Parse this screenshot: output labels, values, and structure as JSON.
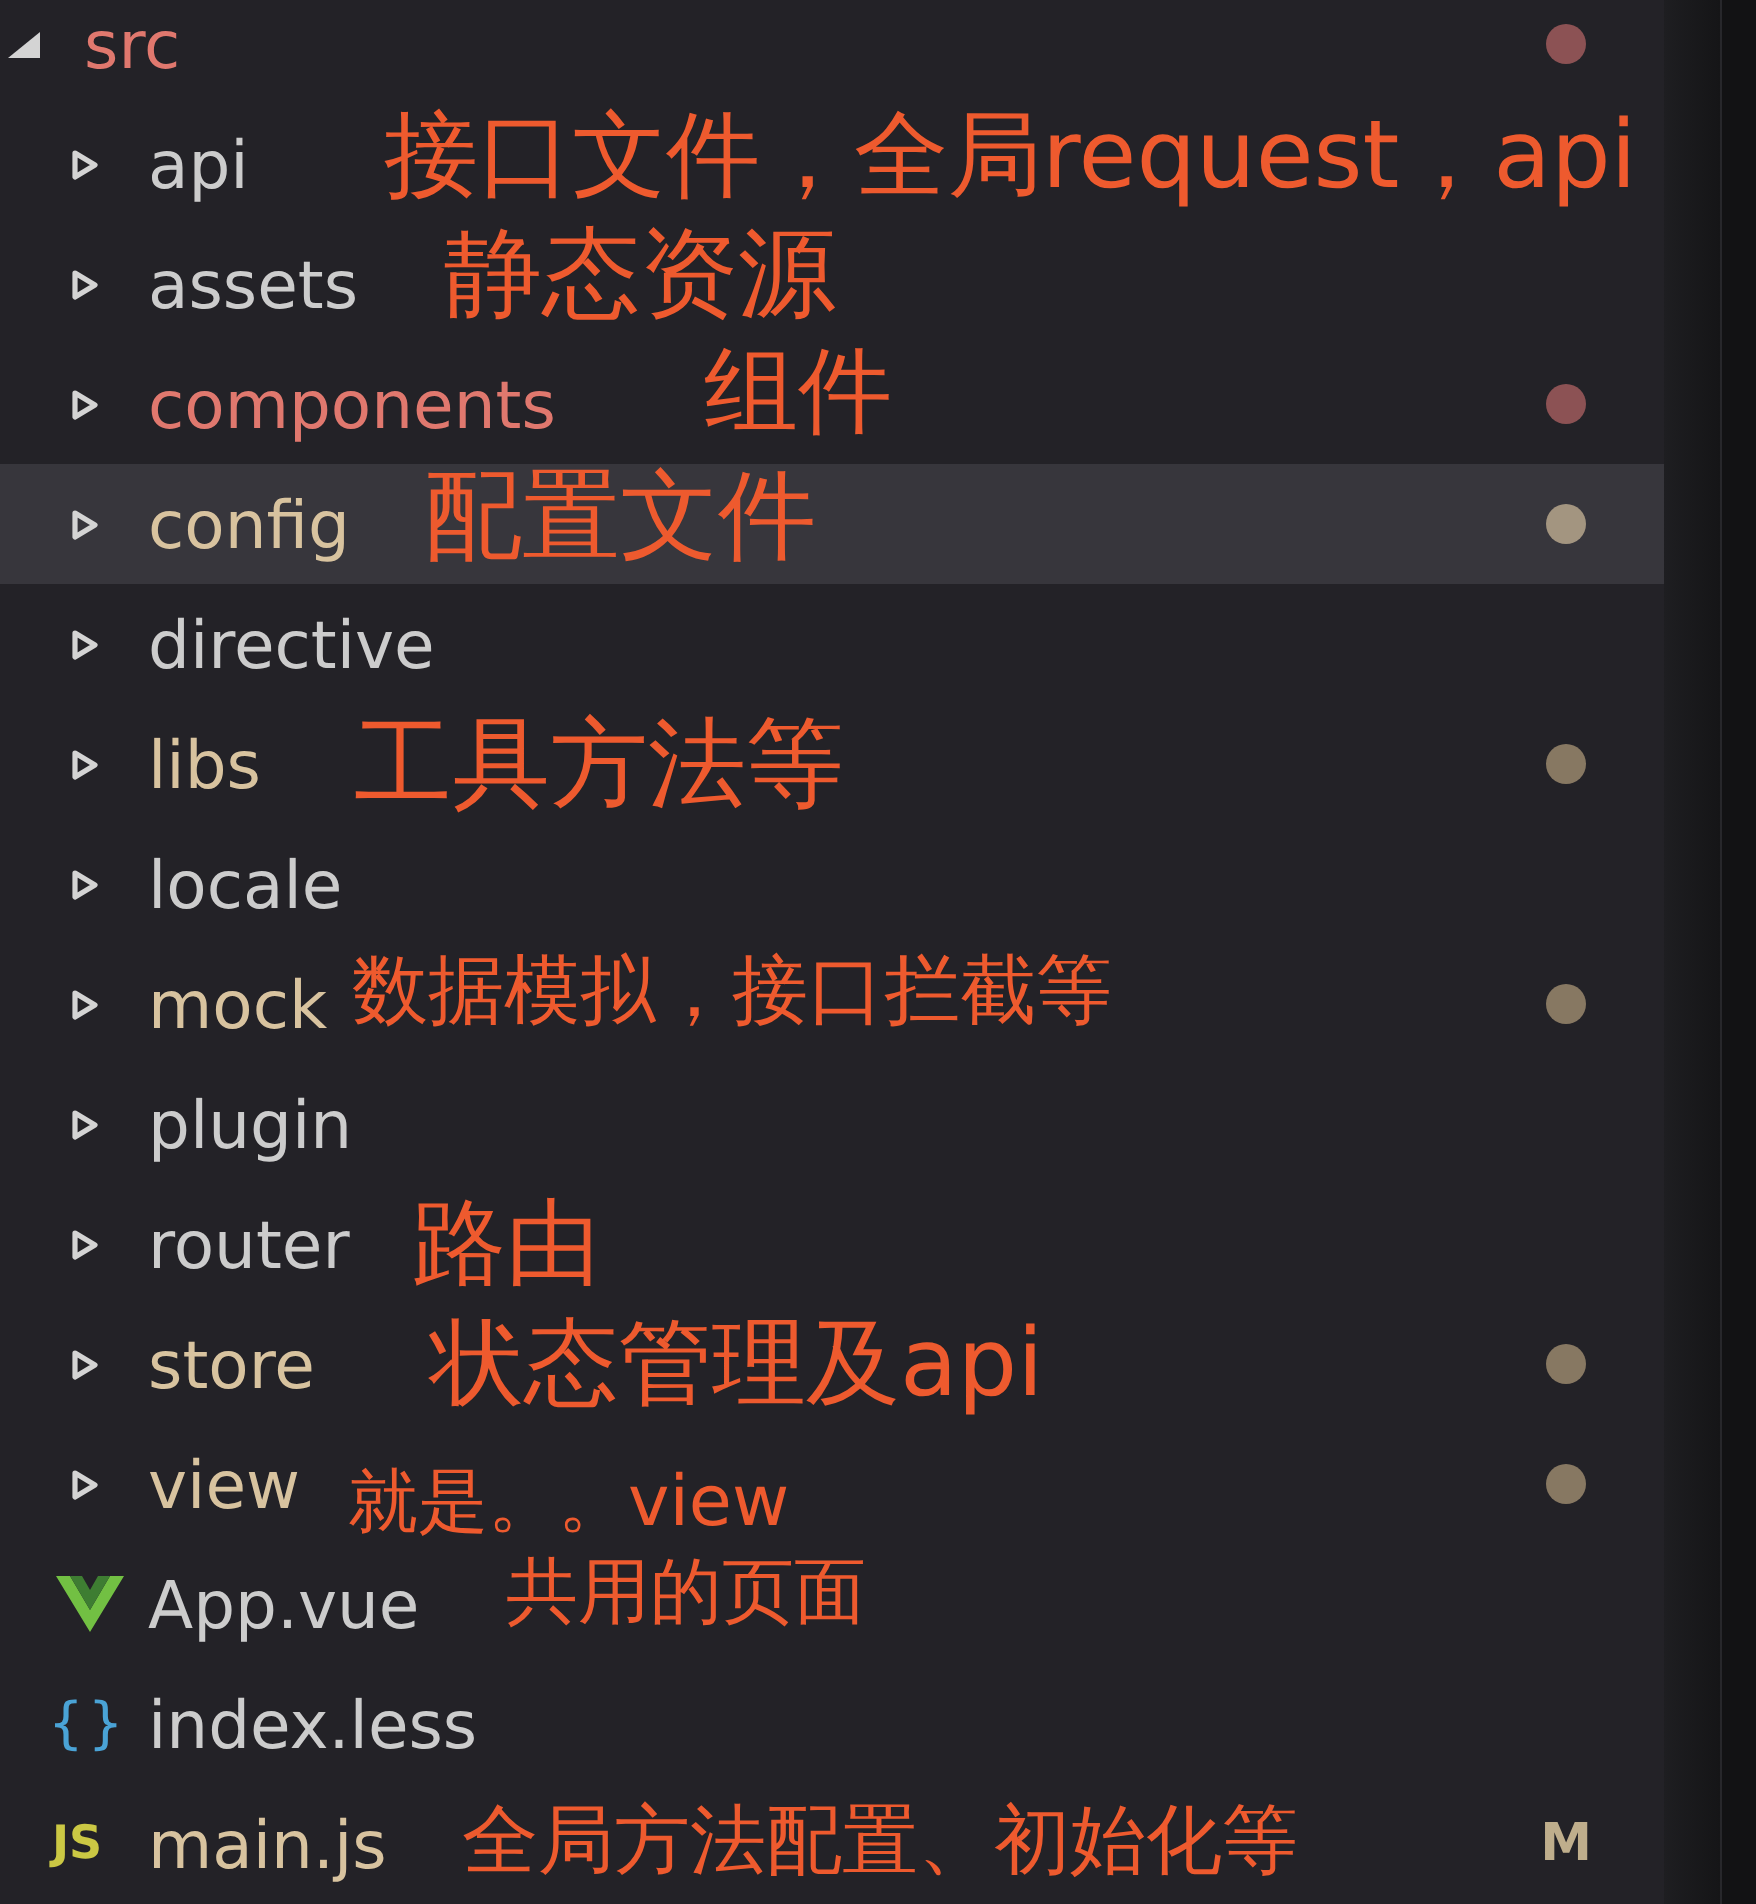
{
  "explorer": {
    "tree": [
      {
        "name": "src",
        "kind": "folder",
        "expanded": true,
        "selected": false,
        "has_errors": true,
        "modified": false,
        "color": "#8c5254",
        "children": [
          {
            "name": "api",
            "kind": "folder",
            "expanded": false,
            "selected": false,
            "has_errors": false,
            "modified": false,
            "annotation": "接口文件，全局request，api"
          },
          {
            "name": "assets",
            "kind": "folder",
            "expanded": false,
            "selected": false,
            "has_errors": false,
            "modified": false,
            "annotation": "静态资源"
          },
          {
            "name": "components",
            "kind": "folder",
            "expanded": false,
            "selected": false,
            "has_errors": true,
            "modified": false,
            "color": "#8c5254",
            "annotation": "组件"
          },
          {
            "name": "config",
            "kind": "folder",
            "expanded": false,
            "selected": true,
            "has_errors": false,
            "modified": true,
            "color": "#a39580",
            "annotation": "配置文件"
          },
          {
            "name": "directive",
            "kind": "folder",
            "expanded": false,
            "selected": false,
            "has_errors": false,
            "modified": false
          },
          {
            "name": "libs",
            "kind": "folder",
            "expanded": false,
            "selected": false,
            "has_errors": false,
            "modified": true,
            "color": "#877862",
            "annotation": "工具方法等"
          },
          {
            "name": "locale",
            "kind": "folder",
            "expanded": false,
            "selected": false,
            "has_errors": false,
            "modified": false
          },
          {
            "name": "mock",
            "kind": "folder",
            "expanded": false,
            "selected": false,
            "has_errors": false,
            "modified": true,
            "color": "#877862",
            "annotation": "数据模拟，接口拦截等"
          },
          {
            "name": "plugin",
            "kind": "folder",
            "expanded": false,
            "selected": false,
            "has_errors": false,
            "modified": false
          },
          {
            "name": "router",
            "kind": "folder",
            "expanded": false,
            "selected": false,
            "has_errors": false,
            "modified": false,
            "annotation": "路由"
          },
          {
            "name": "store",
            "kind": "folder",
            "expanded": false,
            "selected": false,
            "has_errors": false,
            "modified": true,
            "color": "#877862",
            "annotation": "状态管理及api"
          },
          {
            "name": "view",
            "kind": "folder",
            "expanded": false,
            "selected": false,
            "has_errors": false,
            "modified": true,
            "color": "#877862",
            "annotation": "就是。。view"
          },
          {
            "name": "App.vue",
            "kind": "vue",
            "selected": false,
            "has_errors": false,
            "modified": false,
            "annotation": "共用的页面"
          },
          {
            "name": "index.less",
            "kind": "less",
            "icon_text": "{}",
            "selected": false,
            "has_errors": false,
            "modified": false
          },
          {
            "name": "main.js",
            "kind": "js",
            "icon_text": "JS",
            "selected": false,
            "has_errors": false,
            "modified": true,
            "badge": "M",
            "annotation": "全局方法配置、初始化等"
          }
        ]
      }
    ]
  }
}
